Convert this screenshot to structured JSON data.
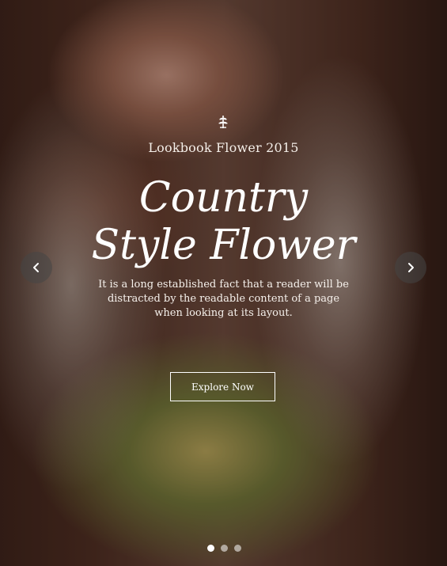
{
  "slider": {
    "kicker": "Lookbook Flower 2015",
    "headline_line1": "Country",
    "headline_line2": "Style Flower",
    "description": "It is a long established fact that a reader will be distracted by the readable content of a page when looking at its layout.",
    "cta_label": "Explore Now",
    "slide_count": 3,
    "active_slide": 1
  },
  "icons": {
    "ornament": "leaf-icon",
    "prev": "chevron-left-icon",
    "next": "chevron-right-icon"
  },
  "colors": {
    "text": "#ffffff",
    "arrow_bg": "#464646",
    "dot_active": "#ffffff"
  }
}
